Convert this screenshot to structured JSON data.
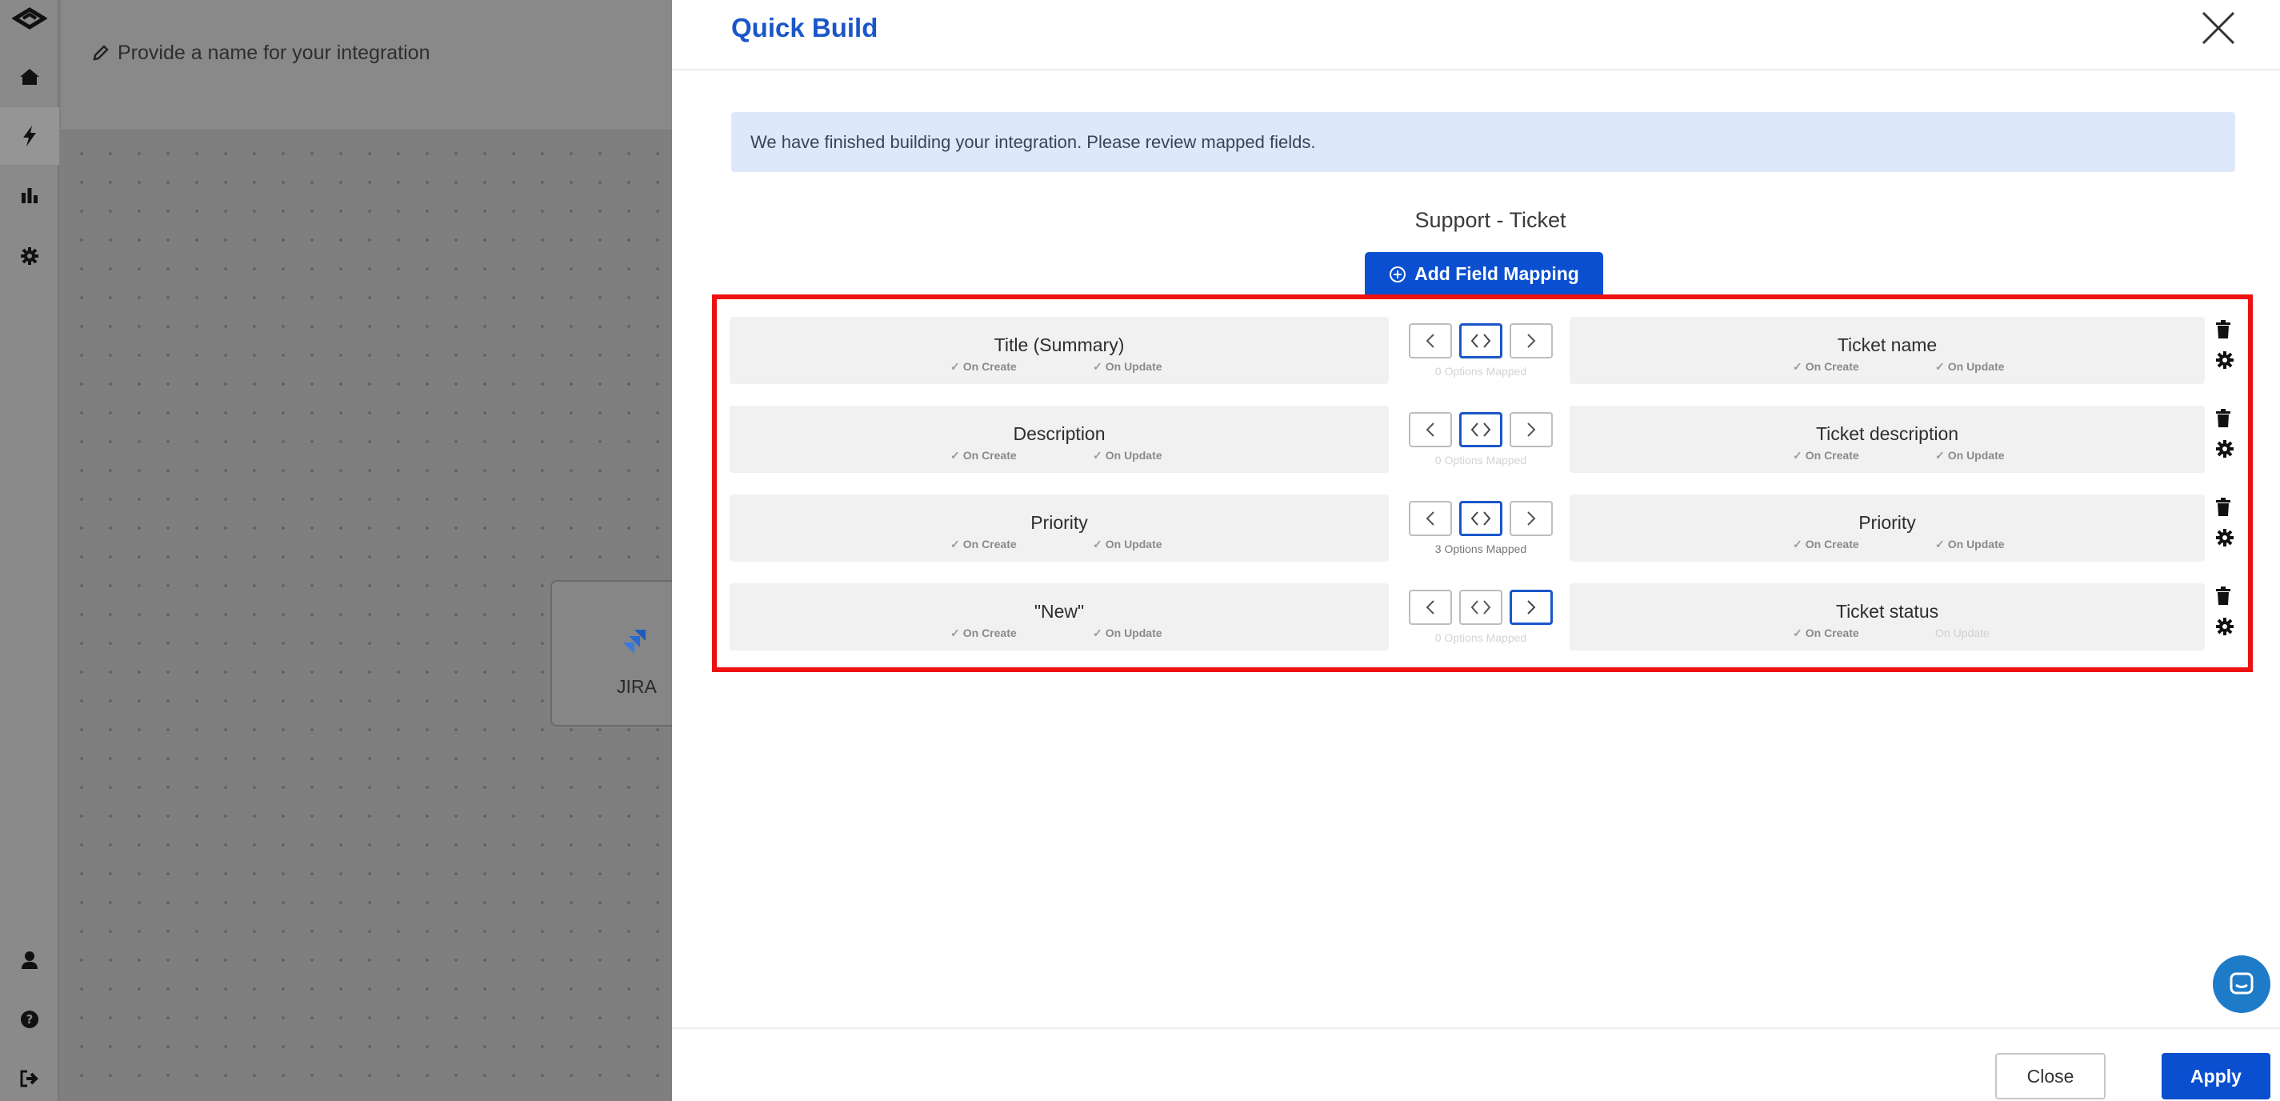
{
  "background": {
    "integration_name_placeholder": "Provide a name for your integration",
    "node_label": "JIRA"
  },
  "rail": {
    "icons": [
      "logo-icon",
      "home-icon",
      "bolt-icon",
      "bar-chart-icon",
      "gear-icon",
      "user-icon",
      "help-icon",
      "logout-icon"
    ],
    "active": "bolt-icon"
  },
  "modal": {
    "title": "Quick Build",
    "info_message": "We have finished building your integration. Please review mapped fields.",
    "section_title": "Support - Ticket",
    "add_button_label": "Add Field Mapping",
    "close_button_label": "Close",
    "apply_button_label": "Apply"
  },
  "mappings": [
    {
      "left": {
        "name": "Title (Summary)",
        "on_create": "On Create",
        "on_update": "On Update"
      },
      "direction": "both",
      "options_mapped": "0 Options Mapped",
      "right": {
        "name": "Ticket name",
        "on_create": "On Create",
        "on_update": "On Update"
      }
    },
    {
      "left": {
        "name": "Description",
        "on_create": "On Create",
        "on_update": "On Update"
      },
      "direction": "both",
      "options_mapped": "0 Options Mapped",
      "right": {
        "name": "Ticket description",
        "on_create": "On Create",
        "on_update": "On Update"
      }
    },
    {
      "left": {
        "name": "Priority",
        "on_create": "On Create",
        "on_update": "On Update"
      },
      "direction": "both",
      "options_mapped": "3 Options Mapped",
      "right": {
        "name": "Priority",
        "on_create": "On Create",
        "on_update": "On Update"
      }
    },
    {
      "left": {
        "name": "\"New\"",
        "on_create": "On Create",
        "on_update": "On Update"
      },
      "direction": "right",
      "options_mapped": "0 Options Mapped",
      "right": {
        "name": "Ticket status",
        "on_create": "On Create",
        "on_update": "On Update",
        "on_update_disabled": true
      }
    }
  ],
  "colors": {
    "accent": "#1a56c9",
    "primary_button": "#0a4fd0",
    "highlight_border": "#ee1111",
    "info_bg": "#dde9fb"
  }
}
